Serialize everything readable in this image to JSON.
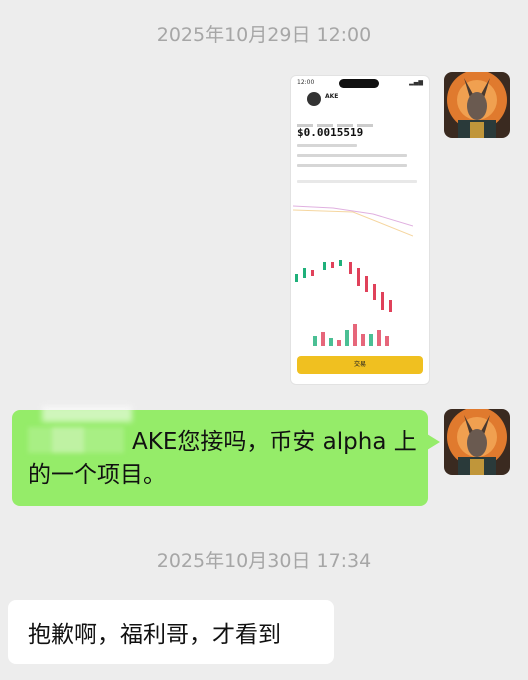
{
  "chat": {
    "timestamp_1": "2025年10月29日 12:00",
    "timestamp_2": "2025年10月30日 17:34",
    "image_message": {
      "price": "$0.0015519",
      "button_label": "交易"
    },
    "text_message_1": "AKE您接吗，币安 alpha 上的一个项目。",
    "text_message_2": "抱歉啊，福利哥，才看到"
  },
  "colors": {
    "background": "#ededed",
    "sent_bubble": "#95ec69",
    "received_bubble": "#ffffff",
    "timestamp": "#a6a6a6"
  },
  "icons": {
    "avatar": "jackal-avatar",
    "image": "app-screenshot-thumbnail"
  }
}
